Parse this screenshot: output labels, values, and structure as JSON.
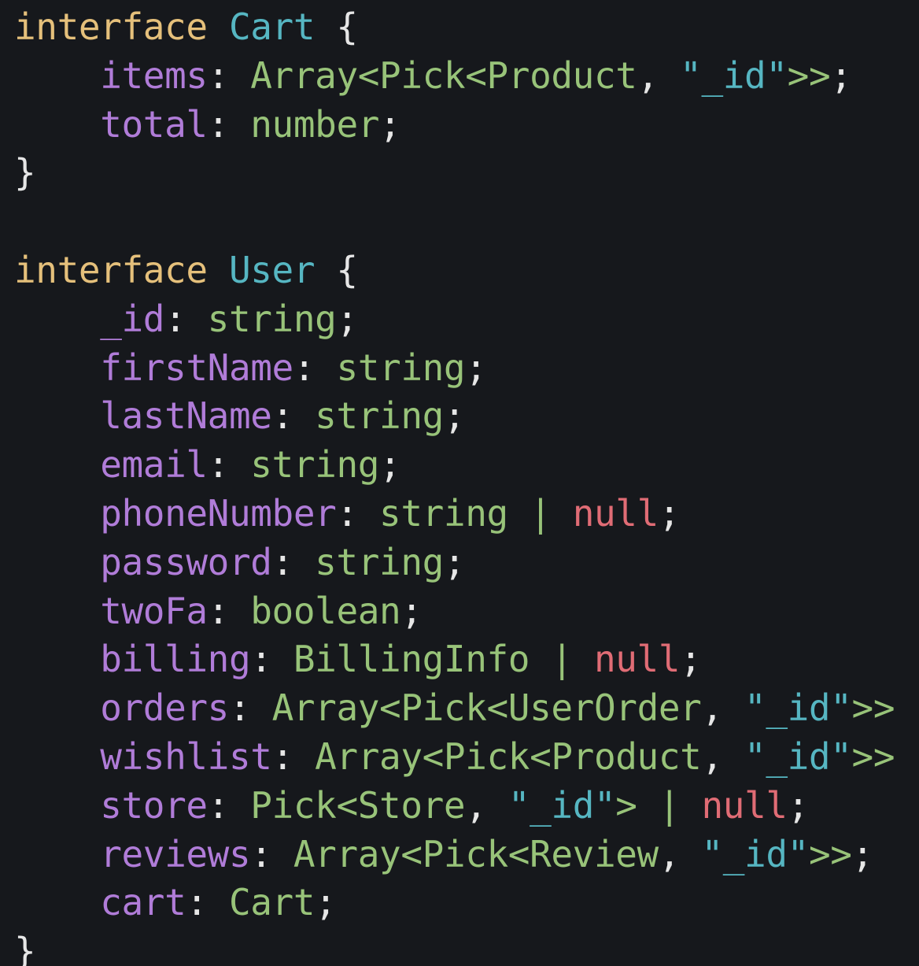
{
  "colors": {
    "background": "#16181c",
    "keyword": "#e5c07b",
    "type_name": "#56b6c2",
    "property": "#b07cd8",
    "type": "#98c379",
    "null": "#e06c75",
    "punctuation": "#e6e6e6"
  },
  "lines": [
    [
      {
        "t": "interface",
        "k": "keyword"
      },
      {
        "t": " ",
        "k": "punct"
      },
      {
        "t": "Cart",
        "k": "type-name"
      },
      {
        "t": " {",
        "k": "brace"
      }
    ],
    [
      {
        "t": "    ",
        "k": "punct"
      },
      {
        "t": "items",
        "k": "prop"
      },
      {
        "t": ": ",
        "k": "punct"
      },
      {
        "t": "Array<Pick<Product",
        "k": "type"
      },
      {
        "t": ", ",
        "k": "punct"
      },
      {
        "t": "\"_id\"",
        "k": "string"
      },
      {
        "t": ">>",
        "k": "type"
      },
      {
        "t": ";",
        "k": "punct"
      }
    ],
    [
      {
        "t": "    ",
        "k": "punct"
      },
      {
        "t": "total",
        "k": "prop"
      },
      {
        "t": ": ",
        "k": "punct"
      },
      {
        "t": "number",
        "k": "type"
      },
      {
        "t": ";",
        "k": "punct"
      }
    ],
    [
      {
        "t": "}",
        "k": "brace"
      }
    ],
    [
      {
        "t": "",
        "k": "punct"
      }
    ],
    [
      {
        "t": "interface",
        "k": "keyword"
      },
      {
        "t": " ",
        "k": "punct"
      },
      {
        "t": "User",
        "k": "type-name"
      },
      {
        "t": " {",
        "k": "brace"
      }
    ],
    [
      {
        "t": "    ",
        "k": "punct"
      },
      {
        "t": "_id",
        "k": "prop"
      },
      {
        "t": ": ",
        "k": "punct"
      },
      {
        "t": "string",
        "k": "type"
      },
      {
        "t": ";",
        "k": "punct"
      }
    ],
    [
      {
        "t": "    ",
        "k": "punct"
      },
      {
        "t": "firstName",
        "k": "prop"
      },
      {
        "t": ": ",
        "k": "punct"
      },
      {
        "t": "string",
        "k": "type"
      },
      {
        "t": ";",
        "k": "punct"
      }
    ],
    [
      {
        "t": "    ",
        "k": "punct"
      },
      {
        "t": "lastName",
        "k": "prop"
      },
      {
        "t": ": ",
        "k": "punct"
      },
      {
        "t": "string",
        "k": "type"
      },
      {
        "t": ";",
        "k": "punct"
      }
    ],
    [
      {
        "t": "    ",
        "k": "punct"
      },
      {
        "t": "email",
        "k": "prop"
      },
      {
        "t": ": ",
        "k": "punct"
      },
      {
        "t": "string",
        "k": "type"
      },
      {
        "t": ";",
        "k": "punct"
      }
    ],
    [
      {
        "t": "    ",
        "k": "punct"
      },
      {
        "t": "phoneNumber",
        "k": "prop"
      },
      {
        "t": ": ",
        "k": "punct"
      },
      {
        "t": "string | ",
        "k": "type"
      },
      {
        "t": "null",
        "k": "null"
      },
      {
        "t": ";",
        "k": "punct"
      }
    ],
    [
      {
        "t": "    ",
        "k": "punct"
      },
      {
        "t": "password",
        "k": "prop"
      },
      {
        "t": ": ",
        "k": "punct"
      },
      {
        "t": "string",
        "k": "type"
      },
      {
        "t": ";",
        "k": "punct"
      }
    ],
    [
      {
        "t": "    ",
        "k": "punct"
      },
      {
        "t": "twoFa",
        "k": "prop"
      },
      {
        "t": ": ",
        "k": "punct"
      },
      {
        "t": "boolean",
        "k": "type"
      },
      {
        "t": ";",
        "k": "punct"
      }
    ],
    [
      {
        "t": "    ",
        "k": "punct"
      },
      {
        "t": "billing",
        "k": "prop"
      },
      {
        "t": ": ",
        "k": "punct"
      },
      {
        "t": "BillingInfo | ",
        "k": "type"
      },
      {
        "t": "null",
        "k": "null"
      },
      {
        "t": ";",
        "k": "punct"
      }
    ],
    [
      {
        "t": "    ",
        "k": "punct"
      },
      {
        "t": "orders",
        "k": "prop"
      },
      {
        "t": ": ",
        "k": "punct"
      },
      {
        "t": "Array<Pick<UserOrder",
        "k": "type"
      },
      {
        "t": ", ",
        "k": "punct"
      },
      {
        "t": "\"_id\"",
        "k": "string"
      },
      {
        "t": ">>",
        "k": "type"
      }
    ],
    [
      {
        "t": "    ",
        "k": "punct"
      },
      {
        "t": "wishlist",
        "k": "prop"
      },
      {
        "t": ": ",
        "k": "punct"
      },
      {
        "t": "Array<Pick<Product",
        "k": "type"
      },
      {
        "t": ", ",
        "k": "punct"
      },
      {
        "t": "\"_id\"",
        "k": "string"
      },
      {
        "t": ">>",
        "k": "type"
      }
    ],
    [
      {
        "t": "    ",
        "k": "punct"
      },
      {
        "t": "store",
        "k": "prop"
      },
      {
        "t": ": ",
        "k": "punct"
      },
      {
        "t": "Pick<Store",
        "k": "type"
      },
      {
        "t": ", ",
        "k": "punct"
      },
      {
        "t": "\"_id\"",
        "k": "string"
      },
      {
        "t": "> | ",
        "k": "type"
      },
      {
        "t": "null",
        "k": "null"
      },
      {
        "t": ";",
        "k": "punct"
      }
    ],
    [
      {
        "t": "    ",
        "k": "punct"
      },
      {
        "t": "reviews",
        "k": "prop"
      },
      {
        "t": ": ",
        "k": "punct"
      },
      {
        "t": "Array<Pick<Review",
        "k": "type"
      },
      {
        "t": ", ",
        "k": "punct"
      },
      {
        "t": "\"_id\"",
        "k": "string"
      },
      {
        "t": ">>",
        "k": "type"
      },
      {
        "t": ";",
        "k": "punct"
      }
    ],
    [
      {
        "t": "    ",
        "k": "punct"
      },
      {
        "t": "cart",
        "k": "prop"
      },
      {
        "t": ": ",
        "k": "punct"
      },
      {
        "t": "Cart",
        "k": "type"
      },
      {
        "t": ";",
        "k": "punct"
      }
    ],
    [
      {
        "t": "}",
        "k": "brace"
      }
    ]
  ]
}
